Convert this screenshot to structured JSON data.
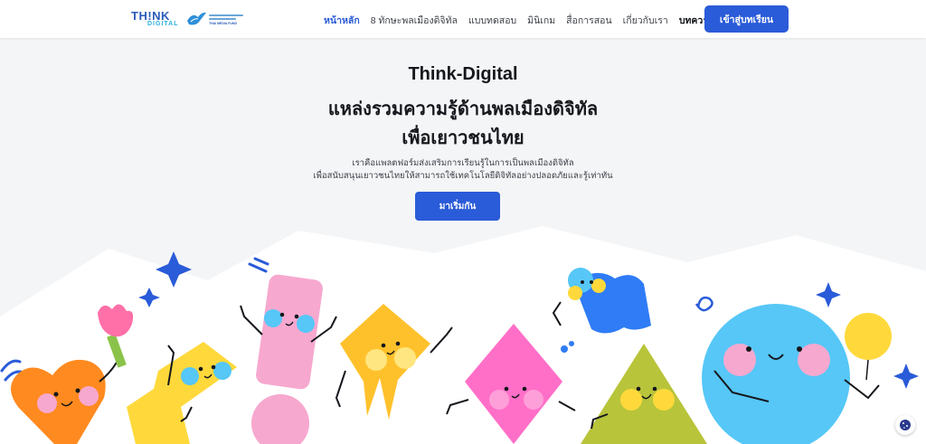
{
  "header": {
    "logo_word": "TH!NK",
    "logo_sub": "DIGITAL",
    "fund_name": "THAI MEDIA FUND",
    "nav": [
      {
        "label": "หน้าหลัก",
        "active": true
      },
      {
        "label": "8 ทักษะพลเมืองดิจิทัล",
        "active": false
      },
      {
        "label": "แบบทดสอบ",
        "active": false
      },
      {
        "label": "มินิเกม",
        "active": false
      },
      {
        "label": "สื่อการสอน",
        "active": false
      },
      {
        "label": "เกี่ยวกับเรา",
        "active": false
      },
      {
        "label": "บทความ",
        "active": false
      }
    ],
    "login_label": "เข้าสู่บทเรียน"
  },
  "hero": {
    "title_1": "Think-Digital",
    "title_2": "แหล่งรวมความรู้ด้านพลเมืองดิจิทัล",
    "title_3": "เพื่อเยาวชนไทย",
    "desc_1": "เราคือแพลตฟอร์มส่งเสริมการเรียนรู้ในการเป็นพลเมืองดิจิทัล",
    "desc_2": "เพื่อสนับสนุนเยาวชนไทยให้สามารถใช้เทคโนโลยีดิจิทัลอย่างปลอดภัยและรู้เท่าทัน",
    "start_label": "มาเริ่มกัน"
  },
  "colors": {
    "primary": "#2a5bd8",
    "background": "#f4f5f7",
    "orange": "#ff8a1f",
    "yellow": "#ffd93b",
    "pink": "#ff6fc8",
    "light_pink": "#f7a8cf",
    "blue": "#2f7cf6",
    "sky": "#56c7f7",
    "olive": "#b8c43a"
  },
  "icons": {
    "cookie": "cookie-icon",
    "sparkle": "sparkle-icon"
  }
}
